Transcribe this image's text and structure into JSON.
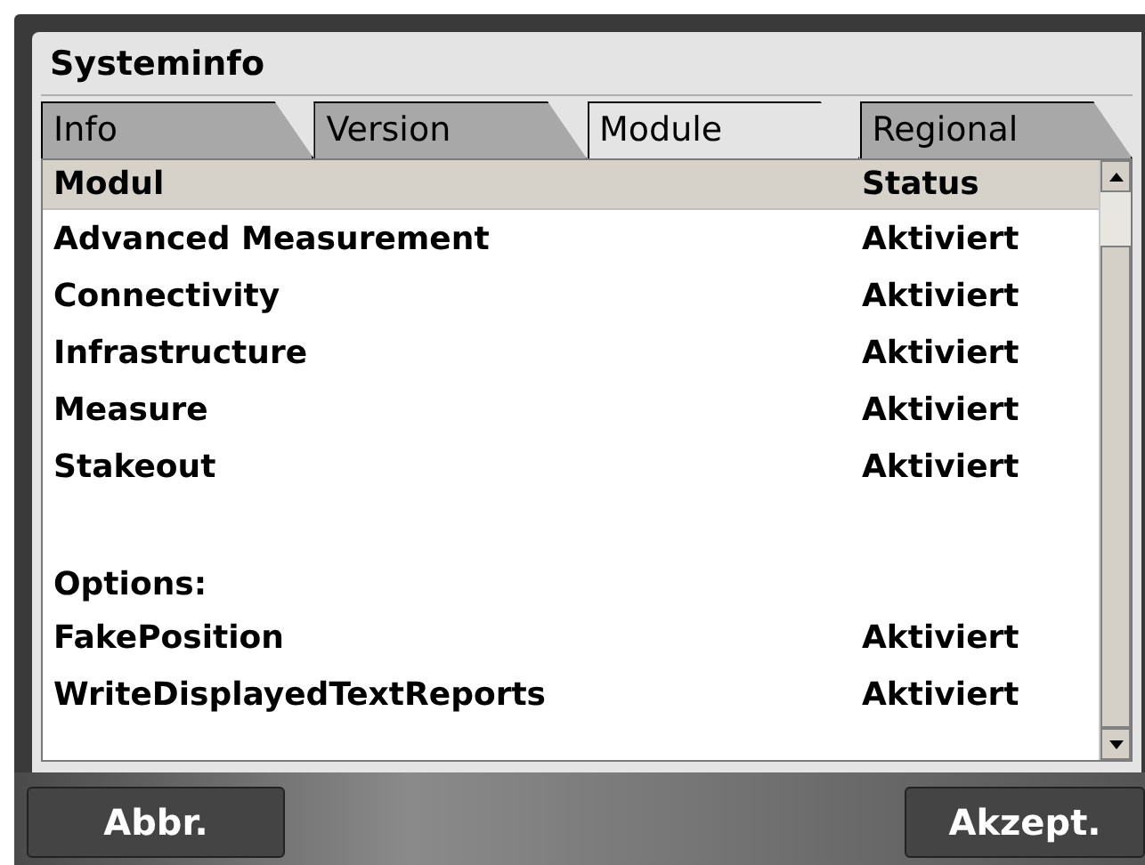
{
  "window": {
    "title": "Systeminfo"
  },
  "tabs": [
    {
      "label": "Info",
      "selected": false
    },
    {
      "label": "Version",
      "selected": false
    },
    {
      "label": "Module",
      "selected": true
    },
    {
      "label": "Regional",
      "selected": false
    }
  ],
  "table": {
    "columns": [
      "Modul",
      "Status"
    ],
    "rows": [
      {
        "kind": "module",
        "name": "Advanced Measurement",
        "status": "Aktiviert"
      },
      {
        "kind": "module",
        "name": "Connectivity",
        "status": "Aktiviert"
      },
      {
        "kind": "module",
        "name": "Infrastructure",
        "status": "Aktiviert"
      },
      {
        "kind": "module",
        "name": "Measure",
        "status": "Aktiviert"
      },
      {
        "kind": "module",
        "name": "Stakeout",
        "status": "Aktiviert"
      },
      {
        "kind": "heading",
        "name": "Options:"
      },
      {
        "kind": "module",
        "name": "FakePosition",
        "status": "Aktiviert"
      },
      {
        "kind": "module",
        "name": "WriteDisplayedTextReports",
        "status": "Aktiviert"
      }
    ]
  },
  "buttons": {
    "cancel": "Abbr.",
    "accept": "Akzept."
  }
}
